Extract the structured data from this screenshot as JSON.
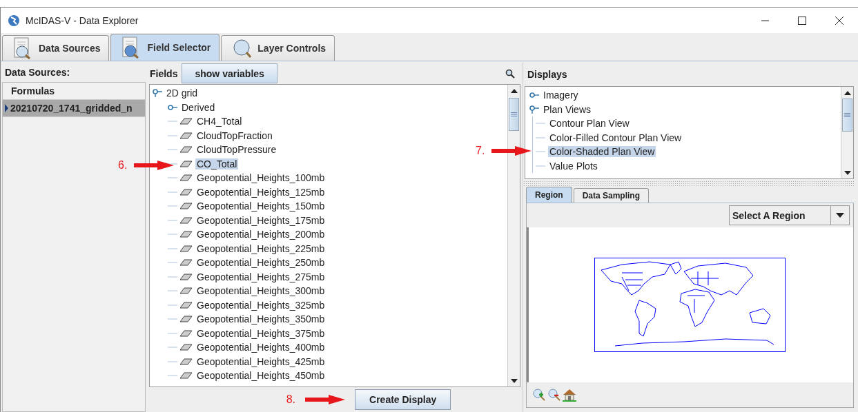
{
  "window": {
    "title": "McIDAS-V - Data Explorer"
  },
  "tabs": [
    {
      "label": "Data Sources",
      "selected": false
    },
    {
      "label": "Field Selector",
      "selected": true
    },
    {
      "label": "Layer Controls",
      "selected": false
    }
  ],
  "data_sources": {
    "header": "Data Sources:",
    "items": [
      {
        "label": "Formulas",
        "selected": false
      },
      {
        "label": "20210720_1741_gridded_n",
        "selected": true
      }
    ]
  },
  "fields": {
    "label": "Fields",
    "button": "show variables",
    "tree": [
      {
        "label": "2D grid",
        "expanded": true,
        "selected": false,
        "children": [
          {
            "label": "Derived",
            "expanded": false,
            "selected": false
          },
          {
            "label": "CH4_Total",
            "selected": false
          },
          {
            "label": "CloudTopFraction",
            "selected": false
          },
          {
            "label": "CloudTopPressure",
            "selected": false
          },
          {
            "label": "CO_Total",
            "selected": true
          },
          {
            "label": "Geopotential_Heights_100mb",
            "selected": false
          },
          {
            "label": "Geopotential_Heights_125mb",
            "selected": false
          },
          {
            "label": "Geopotential_Heights_150mb",
            "selected": false
          },
          {
            "label": "Geopotential_Heights_175mb",
            "selected": false
          },
          {
            "label": "Geopotential_Heights_200mb",
            "selected": false
          },
          {
            "label": "Geopotential_Heights_225mb",
            "selected": false
          },
          {
            "label": "Geopotential_Heights_250mb",
            "selected": false
          },
          {
            "label": "Geopotential_Heights_275mb",
            "selected": false
          },
          {
            "label": "Geopotential_Heights_300mb",
            "selected": false
          },
          {
            "label": "Geopotential_Heights_325mb",
            "selected": false
          },
          {
            "label": "Geopotential_Heights_350mb",
            "selected": false
          },
          {
            "label": "Geopotential_Heights_375mb",
            "selected": false
          },
          {
            "label": "Geopotential_Heights_400mb",
            "selected": false
          },
          {
            "label": "Geopotential_Heights_425mb",
            "selected": false
          },
          {
            "label": "Geopotential_Heights_450mb",
            "selected": false
          }
        ]
      }
    ]
  },
  "displays": {
    "label": "Displays",
    "tree": [
      {
        "label": "Imagery",
        "expanded": false,
        "selected": false
      },
      {
        "label": "Plan Views",
        "expanded": true,
        "selected": false,
        "children": [
          {
            "label": "Contour Plan View",
            "selected": false
          },
          {
            "label": "Color-Filled Contour Plan View",
            "selected": false
          },
          {
            "label": "Color-Shaded Plan View",
            "selected": true
          },
          {
            "label": "Value Plots",
            "selected": false
          }
        ]
      }
    ]
  },
  "region_tabs": [
    {
      "label": "Region",
      "selected": true
    },
    {
      "label": "Data Sampling",
      "selected": false
    }
  ],
  "region_select": {
    "value": "Select A Region"
  },
  "create_button": "Create Display",
  "annotations": [
    "6.",
    "7.",
    "8."
  ]
}
